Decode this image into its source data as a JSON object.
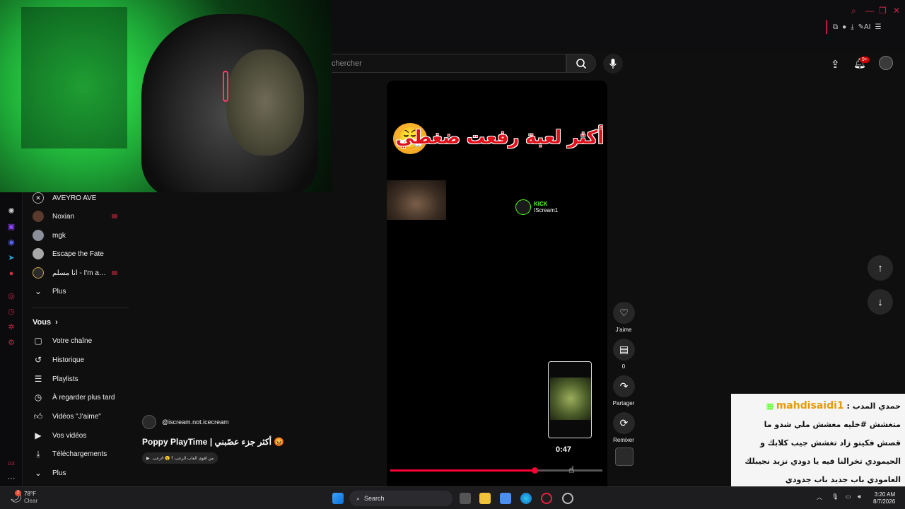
{
  "window": {
    "controls": [
      "search-icon",
      "minimize-icon",
      "restore-icon",
      "close-icon"
    ],
    "extensions": [
      "puzzle-icon",
      "profile-icon",
      "download-icon"
    ],
    "ai_label": "AI"
  },
  "webcam": {
    "description_visible": false
  },
  "search": {
    "placeholder": "chercher"
  },
  "header": {
    "notification_count": "9+"
  },
  "sidebar": {
    "subscriptions": [
      {
        "label": "AVEYRO AVE",
        "icon": "channel-avatar",
        "live": false
      },
      {
        "label": "Noxian",
        "icon": "channel-avatar",
        "live": true
      },
      {
        "label": "mgk",
        "icon": "channel-avatar",
        "live": false
      },
      {
        "label": "Escape the Fate",
        "icon": "channel-avatar",
        "live": false
      },
      {
        "label": "أنا مسلم - I'm a Mus…",
        "icon": "channel-avatar",
        "live": true
      },
      {
        "label": "Plus",
        "icon": "chevron-down-icon",
        "live": false
      }
    ],
    "you_heading": "Vous",
    "you_items": [
      {
        "label": "Votre chaîne",
        "icon": "channel-icon"
      },
      {
        "label": "Historique",
        "icon": "history-icon"
      },
      {
        "label": "Playlists",
        "icon": "playlist-icon"
      },
      {
        "label": "À regarder plus tard",
        "icon": "clock-icon"
      },
      {
        "label": "Vidéos \"J'aime\"",
        "icon": "thumbs-up-icon"
      },
      {
        "label": "Vos vidéos",
        "icon": "video-icon"
      },
      {
        "label": "Téléchargements",
        "icon": "download-icon"
      },
      {
        "label": "Plus",
        "icon": "chevron-down-icon"
      }
    ]
  },
  "short": {
    "overlay_title": "أكثر لعبة رفعت ضغطي",
    "kick_brand": "KICK",
    "kick_user": "IScream1",
    "time": "0:47",
    "progress": 0.68,
    "channel_handle": "@iscream.not.icecream",
    "title": "Poppy PlayTime | أكثر جزء عصّبني 😡",
    "sound_label": "من اقوى العاب الرعب ؟ 😮 #رعب"
  },
  "actions": {
    "like_label": "J'aime",
    "comment_count": "0",
    "share_label": "Partager",
    "remix_label": "Remixer"
  },
  "chat": {
    "username": "mahdisaidi1",
    "lines": [
      "حمدي المدب :",
      "متغشش #خليه مغشش ملي شدو ما",
      "قصش فكيتو زاد تغشش جيب كلابك و",
      "الحيمودي تخرالنا فيه يا دودي نزيد نجيبلك",
      "العامودي باب جديد باب جدودي"
    ]
  },
  "taskbar": {
    "weather_temp": "78°F",
    "weather_desc": "Clear",
    "weather_badge": "2",
    "search_label": "Search",
    "time": "3:20 AM",
    "date": "8/7/2026"
  },
  "colors": {
    "accent_red": "#ff0033",
    "kick_green": "#53fc18",
    "chat_username": "#e69a0b"
  }
}
